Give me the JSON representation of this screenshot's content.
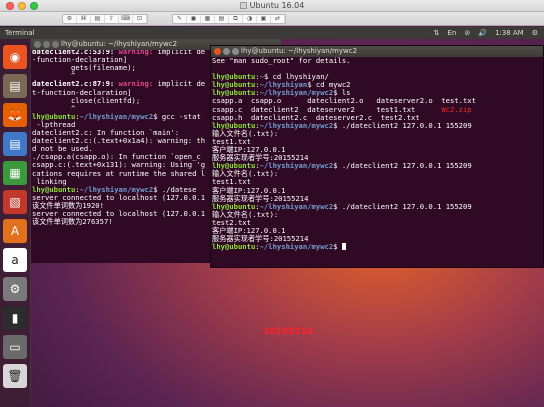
{
  "vm": {
    "title": "Ubuntu 16.04",
    "toolbar_buttons": [
      "⚙",
      "⌘",
      "▤",
      "⇧",
      "⌨",
      "⊡",
      "✎",
      "◼",
      "▦",
      "▤",
      "⧉",
      "◑",
      "▣",
      "⇄"
    ]
  },
  "panel": {
    "app_name": "Terminal",
    "indicators": [
      "⇅",
      "En",
      "⊘",
      "🔊",
      "1:38 AM",
      "⚙"
    ]
  },
  "launcher": {
    "items": [
      {
        "name": "ubuntu-logo-icon",
        "glyph": "◉",
        "bg": "#e95420"
      },
      {
        "name": "files-icon",
        "glyph": "▤",
        "bg": "#7a6a55"
      },
      {
        "name": "firefox-icon",
        "glyph": "🦊",
        "bg": "#e66000"
      },
      {
        "name": "writer-icon",
        "glyph": "▤",
        "bg": "#3e78c6"
      },
      {
        "name": "calc-icon",
        "glyph": "▦",
        "bg": "#3c9a3c"
      },
      {
        "name": "impress-icon",
        "glyph": "▧",
        "bg": "#c0392b"
      },
      {
        "name": "software-center-icon",
        "glyph": "A",
        "bg": "#e2701d"
      },
      {
        "name": "amazon-icon",
        "glyph": "a",
        "bg": "#ffffff"
      },
      {
        "name": "system-settings-icon",
        "glyph": "⚙",
        "bg": "#7a7a7a"
      },
      {
        "name": "terminal-icon",
        "glyph": "▮",
        "bg": "#2c2c2c"
      },
      {
        "name": "disk-icon",
        "glyph": "▭",
        "bg": "#6a6a6a"
      },
      {
        "name": "trash-icon",
        "glyph": "🗑",
        "bg": "#d6d6d6"
      }
    ]
  },
  "term_back": {
    "title": "lhy@ubuntu: ~/lhyshiyan/mywc2",
    "lines": [
      {
        "parts": [
          {
            "t": "               ^",
            "c": ""
          }
        ]
      },
      {
        "parts": [
          {
            "t": "dateclient2.c:53:9: ",
            "c": "c-bold"
          },
          {
            "t": "warning: ",
            "c": "c-magenta"
          },
          {
            "t": "implicit de",
            "c": ""
          }
        ]
      },
      {
        "parts": [
          {
            "t": "-function-declaration]",
            "c": ""
          }
        ]
      },
      {
        "parts": [
          {
            "t": "         gets(filename);",
            "c": ""
          }
        ]
      },
      {
        "parts": [
          {
            "t": "         ^",
            "c": ""
          }
        ]
      },
      {
        "parts": [
          {
            "t": "dateclient2.c:87:9: ",
            "c": "c-bold"
          },
          {
            "t": "warning: ",
            "c": "c-magenta"
          },
          {
            "t": "implicit de",
            "c": ""
          }
        ]
      },
      {
        "parts": [
          {
            "t": "t-function-declaration]",
            "c": ""
          }
        ]
      },
      {
        "parts": [
          {
            "t": "         close(clientfd);",
            "c": ""
          }
        ]
      },
      {
        "parts": [
          {
            "t": "         ^",
            "c": ""
          }
        ]
      },
      {
        "parts": [
          {
            "t": "lhy@ubuntu",
            "c": "p-user"
          },
          {
            "t": ":",
            "c": ""
          },
          {
            "t": "~/lhyshiyan/mywc2",
            "c": "p-path"
          },
          {
            "t": "$ gcc -stat",
            "c": ""
          }
        ]
      },
      {
        "parts": [
          {
            "t": " -lpthread",
            "c": ""
          }
        ]
      },
      {
        "parts": [
          {
            "t": "dateclient2.c: In function `main':",
            "c": ""
          }
        ]
      },
      {
        "parts": [
          {
            "t": "dateclient2.c:(.text+0x1a4): warning: th",
            "c": ""
          }
        ]
      },
      {
        "parts": [
          {
            "t": "d not be used.",
            "c": ""
          }
        ]
      },
      {
        "parts": [
          {
            "t": "./csapp.a(csapp.o): In function `open_c",
            "c": ""
          }
        ]
      },
      {
        "parts": [
          {
            "t": "csapp.c:(.text+0x131): warning: Using 'g",
            "c": ""
          }
        ]
      },
      {
        "parts": [
          {
            "t": "cations requires at runtime the shared l",
            "c": ""
          }
        ]
      },
      {
        "parts": [
          {
            "t": " linking",
            "c": ""
          }
        ]
      },
      {
        "parts": [
          {
            "t": "lhy@ubuntu",
            "c": "p-user"
          },
          {
            "t": ":",
            "c": ""
          },
          {
            "t": "~/lhyshiyan/mywc2",
            "c": "p-path"
          },
          {
            "t": "$ ./datese",
            "c": ""
          }
        ]
      },
      {
        "parts": [
          {
            "t": "server connected to localhost (127.0.0.1",
            "c": ""
          }
        ]
      },
      {
        "parts": [
          {
            "t": "该文件单词数为1920!",
            "c": ""
          }
        ]
      },
      {
        "parts": [
          {
            "t": "server connected to localhost (127.0.0.1",
            "c": ""
          }
        ]
      },
      {
        "parts": [
          {
            "t": "该文件单词数为276357!",
            "c": ""
          }
        ]
      }
    ]
  },
  "term_front": {
    "title": "lhy@ubuntu: ~/lhyshiyan/mywc2",
    "lines": [
      {
        "parts": [
          {
            "t": "See \"man sudo_root\" for details.",
            "c": ""
          }
        ]
      },
      {
        "parts": [
          {
            "t": "",
            "c": ""
          }
        ]
      },
      {
        "parts": [
          {
            "t": "lhy@ubuntu",
            "c": "p-user"
          },
          {
            "t": ":",
            "c": ""
          },
          {
            "t": "~",
            "c": "p-path"
          },
          {
            "t": "$ cd lhyshiyan/",
            "c": ""
          }
        ]
      },
      {
        "parts": [
          {
            "t": "lhy@ubuntu",
            "c": "p-user"
          },
          {
            "t": ":",
            "c": ""
          },
          {
            "t": "~/lhyshiyan",
            "c": "p-path"
          },
          {
            "t": "$ cd mywc2",
            "c": ""
          }
        ]
      },
      {
        "parts": [
          {
            "t": "lhy@ubuntu",
            "c": "p-user"
          },
          {
            "t": ":",
            "c": ""
          },
          {
            "t": "~/lhyshiyan/mywc2",
            "c": "p-path"
          },
          {
            "t": "$ ls",
            "c": ""
          }
        ]
      },
      {
        "parts": [
          {
            "t": "csapp.a  csapp.o      dateclient2.o   dateserver2.o  test.txt",
            "c": ""
          }
        ]
      },
      {
        "parts": [
          {
            "t": "csapp.c  dateclient2  dateserver2     test1.txt      ",
            "c": ""
          },
          {
            "t": "Wc2.zip",
            "c": "c-red"
          }
        ]
      },
      {
        "parts": [
          {
            "t": "csapp.h  dateclient2.c  dateserver2.c  test2.txt",
            "c": ""
          }
        ]
      },
      {
        "parts": [
          {
            "t": "lhy@ubuntu",
            "c": "p-user"
          },
          {
            "t": ":",
            "c": ""
          },
          {
            "t": "~/lhyshiyan/mywc2",
            "c": "p-path"
          },
          {
            "t": "$ ./dateclient2 127.0.0.1 155209",
            "c": ""
          }
        ]
      },
      {
        "parts": [
          {
            "t": "输入文件名(.txt):",
            "c": ""
          }
        ]
      },
      {
        "parts": [
          {
            "t": "test1.txt",
            "c": ""
          }
        ]
      },
      {
        "parts": [
          {
            "t": "客户端IP:127.0.0.1",
            "c": ""
          }
        ]
      },
      {
        "parts": [
          {
            "t": "服务器实现者学号:20155214",
            "c": ""
          }
        ]
      },
      {
        "parts": [
          {
            "t": "lhy@ubuntu",
            "c": "p-user"
          },
          {
            "t": ":",
            "c": ""
          },
          {
            "t": "~/lhyshiyan/mywc2",
            "c": "p-path"
          },
          {
            "t": "$ ./dateclient2 127.0.0.1 155209",
            "c": ""
          }
        ]
      },
      {
        "parts": [
          {
            "t": "输入文件名(.txt):",
            "c": ""
          }
        ]
      },
      {
        "parts": [
          {
            "t": "test1.txt",
            "c": ""
          }
        ]
      },
      {
        "parts": [
          {
            "t": "客户端IP:127.0.0.1",
            "c": ""
          }
        ]
      },
      {
        "parts": [
          {
            "t": "服务器实现者学号:20155214",
            "c": ""
          }
        ]
      },
      {
        "parts": [
          {
            "t": "lhy@ubuntu",
            "c": "p-user"
          },
          {
            "t": ":",
            "c": ""
          },
          {
            "t": "~/lhyshiyan/mywc2",
            "c": "p-path"
          },
          {
            "t": "$ ./dateclient2 127.0.0.1 155209",
            "c": ""
          }
        ]
      },
      {
        "parts": [
          {
            "t": "输入文件名(.txt):",
            "c": ""
          }
        ]
      },
      {
        "parts": [
          {
            "t": "test2.txt",
            "c": ""
          }
        ]
      },
      {
        "parts": [
          {
            "t": "客户端IP:127.0.0.1",
            "c": ""
          }
        ]
      },
      {
        "parts": [
          {
            "t": "服务器实现者学号:20155214",
            "c": ""
          }
        ]
      },
      {
        "parts": [
          {
            "t": "lhy@ubuntu",
            "c": "p-user"
          },
          {
            "t": ":",
            "c": ""
          },
          {
            "t": "~/lhyshiyan/mywc2",
            "c": "p-path"
          },
          {
            "t": "$ ",
            "c": ""
          }
        ],
        "cursor": true
      }
    ]
  },
  "overlay": {
    "text": "20155214"
  }
}
